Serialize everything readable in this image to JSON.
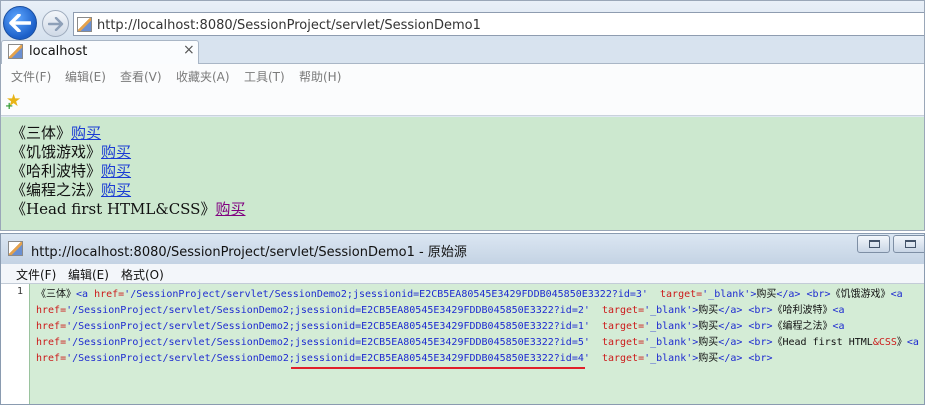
{
  "browser": {
    "url": "http://localhost:8080/SessionProject/servlet/SessionDemo1",
    "tab_title": "localhost",
    "tab_close": "×",
    "menu": [
      "文件(F)",
      "编辑(E)",
      "查看(V)",
      "收藏夹(A)",
      "工具(T)",
      "帮助(H)"
    ],
    "books": [
      {
        "title": "《三体》",
        "link": "购买"
      },
      {
        "title": "《饥饿游戏》",
        "link": "购买"
      },
      {
        "title": "《哈利波特》",
        "link": "购买"
      },
      {
        "title": "《编程之法》",
        "link": "购买"
      },
      {
        "title": "《Head first HTML&CSS》",
        "link": "购买"
      }
    ]
  },
  "source_window": {
    "title": "http://localhost:8080/SessionProject/servlet/SessionDemo1 - 原始源",
    "menu": [
      "文件(F)",
      "编辑(E)",
      "格式(O)"
    ],
    "line_number": "1",
    "code": {
      "l1_a": "《三体》",
      "l1_b": "<a ",
      "l1_c": "href=",
      "l1_d": "'/SessionProject/servlet/SessionDemo2;jsessionid=E2CB5EA80545E3429FDDB045850E3322?id=3'",
      "l1_e": "  target=",
      "l1_f": "'_blank'",
      "l1_g": ">",
      "l1_h": "购买",
      "l1_i": "</a>",
      "l1_j": " <br>",
      "l1_k": "《饥饿游戏》",
      "l1_l": "<a",
      "l2_a": "href=",
      "l2_b": "'/SessionProject/servlet/SessionDemo2;jsessionid=E2CB5EA80545E3429FDDB045850E3322?id=2'",
      "l2_c": "  target=",
      "l2_d": "'_blank'",
      "l2_e": ">",
      "l2_f": "购买",
      "l2_g": "</a>",
      "l2_h": " <br>",
      "l2_i": "《哈利波特》",
      "l2_j": "<a",
      "l3_a": "href=",
      "l3_b": "'/SessionProject/servlet/SessionDemo2;jsessionid=E2CB5EA80545E3429FDDB045850E3322?id=1'",
      "l3_c": "  target=",
      "l3_d": "'_blank'",
      "l3_e": ">",
      "l3_f": "购买",
      "l3_g": "</a>",
      "l3_h": " <br>",
      "l3_i": "《编程之法》",
      "l3_j": "<a",
      "l4_a": "href=",
      "l4_b": "'/SessionProject/servlet/SessionDemo2;jsessionid=E2CB5EA80545E3429FDDB045850E3322?id=5'",
      "l4_c": "  target=",
      "l4_d": "'_blank'",
      "l4_e": ">",
      "l4_f": "购买",
      "l4_g": "</a>",
      "l4_h": " <br>",
      "l4_i": "《Head first HTML",
      "l4_j": "&CSS",
      "l4_k": "》",
      "l4_l": "<a",
      "l5_a": "href=",
      "l5_b": "'/SessionProject/servlet/SessionDemo2;jsessionid=E2CB5EA80545E3429FDDB045850E3322?id=4'",
      "l5_c": "  target=",
      "l5_d": "'_blank'",
      "l5_e": ">",
      "l5_f": "购买",
      "l5_g": "</a>",
      "l5_h": " <br>"
    }
  },
  "colors": {
    "page_background": "#cce8cf",
    "link": "#1a3bd4",
    "visited_link": "#800080",
    "source_tag": "#1e2bd0",
    "source_attr": "#cc1b1b",
    "highlight_underline": "#e0202a"
  }
}
